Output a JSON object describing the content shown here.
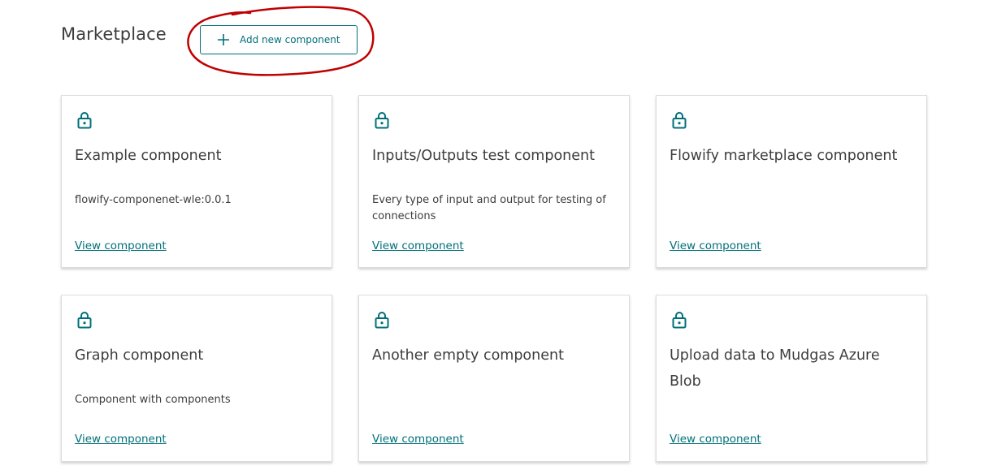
{
  "header": {
    "title": "Marketplace",
    "add_button_label": "Add new component"
  },
  "colors": {
    "accent": "#007079",
    "annotation": "#c00000",
    "text": "#3d3d3d"
  },
  "cards": [
    {
      "title": "Example component",
      "description": "flowify-componenet-wle:0.0.1",
      "link": "View component",
      "icon": "lock-icon"
    },
    {
      "title": "Inputs/Outputs test component",
      "description": "Every type of input and output for testing of connections",
      "link": "View component",
      "icon": "lock-icon"
    },
    {
      "title": "Flowify marketplace component",
      "description": "",
      "link": "View component",
      "icon": "lock-icon"
    },
    {
      "title": "Graph component",
      "description": "Component with components",
      "link": "View component",
      "icon": "lock-icon"
    },
    {
      "title": "Another empty component",
      "description": "",
      "link": "View component",
      "icon": "lock-icon"
    },
    {
      "title": "Upload data to Mudgas Azure Blob",
      "description": "",
      "link": "View component",
      "icon": "lock-icon"
    }
  ]
}
